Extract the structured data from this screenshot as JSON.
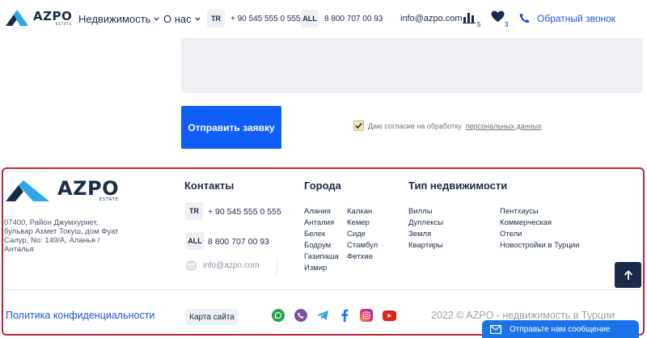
{
  "header": {
    "logo_text": "AZPO",
    "logo_sub": "ESTATE",
    "nav": [
      {
        "label": "Недвижимость"
      },
      {
        "label": "О нас"
      }
    ],
    "phones": [
      {
        "badge": "TR",
        "number": "+ 90 545 555 0 555"
      },
      {
        "badge": "ALL",
        "number": "8 800 707 00 93"
      }
    ],
    "email": "info@azpo.com",
    "compare_count": "5",
    "favorites_count": "3",
    "callback_label": "Обратный звонок"
  },
  "form": {
    "submit_label": "Отправить заявку",
    "consent_text": "Даю согласие на обработку",
    "consent_link": "персональных данных",
    "consent_checked": true
  },
  "footer": {
    "logo_text": "AZPO",
    "logo_sub": "ESTATE",
    "address": "07400, Район Джумхуриет, бульвар Ахмет Токуш, дом Фуат Салур, No: 149/A, Аланья / Анталья",
    "contacts_title": "Контакты",
    "phones": [
      {
        "badge": "TR",
        "number": "+ 90 545 555 0 555"
      },
      {
        "badge": "ALL",
        "number": "8 800 707 00 93"
      }
    ],
    "email": "info@azpo.com",
    "cities_title": "Города",
    "cities_col1": [
      "Алания",
      "Анталия",
      "Белек",
      "Бодрум",
      "Газипаша",
      "Измир"
    ],
    "cities_col2": [
      "Калкан",
      "Кемер",
      "Сиде",
      "Стамбул",
      "Фетхие"
    ],
    "types_title": "Тип недвижимости",
    "types_col1": [
      "Виллы",
      "Дуплексы",
      "Земля",
      "Квартиры"
    ],
    "types_col2": [
      "Пентхаусы",
      "Коммерческая",
      "Отели",
      "Новостройки в Турции"
    ],
    "privacy_label": "Политика конфиденциальности",
    "sitemap_label": "Карта сайта",
    "socials": [
      {
        "icon": "whatsapp-icon",
        "color": "#25a244"
      },
      {
        "icon": "viber-icon",
        "color": "#7b519d"
      },
      {
        "icon": "telegram-icon",
        "color": "#2b9fd9"
      },
      {
        "icon": "facebook-icon",
        "color": "#1877f2"
      },
      {
        "icon": "instagram-icon",
        "color": "#e1306c"
      },
      {
        "icon": "youtube-icon",
        "color": "#e62117"
      }
    ],
    "copyright": "2022 © AZPO - недвижимость в Турции"
  },
  "chat": {
    "label": "Отправьте нам сообщение"
  },
  "colors": {
    "accent": "#0f5ef7",
    "navy": "#1a2b49",
    "footer_border": "#c0203a"
  }
}
